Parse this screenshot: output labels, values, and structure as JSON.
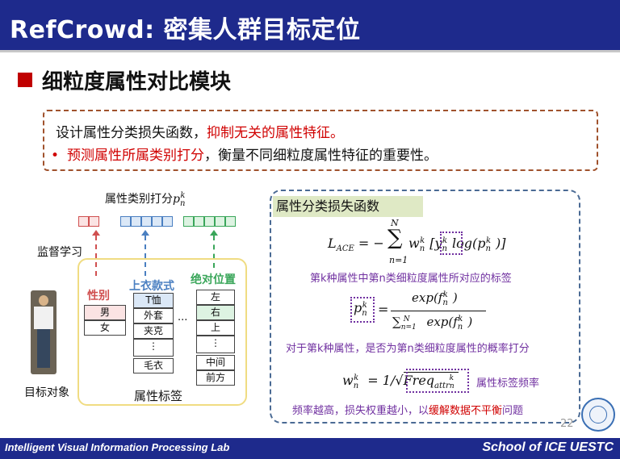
{
  "header": {
    "title": "RefCrowd: 密集人群目标定位"
  },
  "section": {
    "title": "细粒度属性对比模块"
  },
  "summary": {
    "line1_plain": "设计属性分类损失函数，",
    "line1_red": "抑制无关的属性特征。",
    "bullet": "•",
    "line2_red": "预测属性所属类别打分",
    "line2_plain": "，衡量不同细粒度属性特征的重要性。"
  },
  "diagram": {
    "score_label": "属性类别打分",
    "score_symbol": "p",
    "score_sup": "k",
    "score_sub": "n",
    "supervised_label": "监督学习",
    "target_label": "目标对象",
    "attr_label_caption": "属性标签",
    "ellipsis": "...",
    "categories": {
      "gender": {
        "name": "性别",
        "values": [
          "男",
          "女"
        ]
      },
      "clothes": {
        "name": "上衣款式",
        "values": [
          "T恤",
          "外套",
          "夹克",
          "⋮",
          "毛衣"
        ]
      },
      "position": {
        "name": "绝对位置",
        "values": [
          "左",
          "右",
          "上",
          "⋮",
          "中间",
          "前方"
        ]
      }
    },
    "colors": {
      "red": "#d05050",
      "blue": "#4a7fc1",
      "green": "#3aa65a"
    }
  },
  "formula_panel": {
    "heading": "属性分类损失函数",
    "loss_formula": "L_ACE = −Σ_{n=1}^{N} w_n^k [y_n^k log(p_n^k)]",
    "loss_note": "第k种属性中第n类细粒度属性所对应的标签",
    "prob_formula": "p_n^k = exp(f_n^k) / Σ_{n=1}^{N} exp(f_n^k)",
    "prob_note": "对于第k种属性，是否为第n类细粒度属性的概率打分",
    "weight_formula": "w_n^k = 1/√(Freq_attr_n^k)",
    "weight_note": "属性标签频率",
    "bottom_plain": "频率越高，损失权重越小，以",
    "bottom_red": "缓解数据不平衡",
    "bottom_end": "问题"
  },
  "page_number": "22",
  "footer": {
    "left": "Intelligent Visual Information Processing Lab",
    "right": "School of ICE   UESTC"
  }
}
